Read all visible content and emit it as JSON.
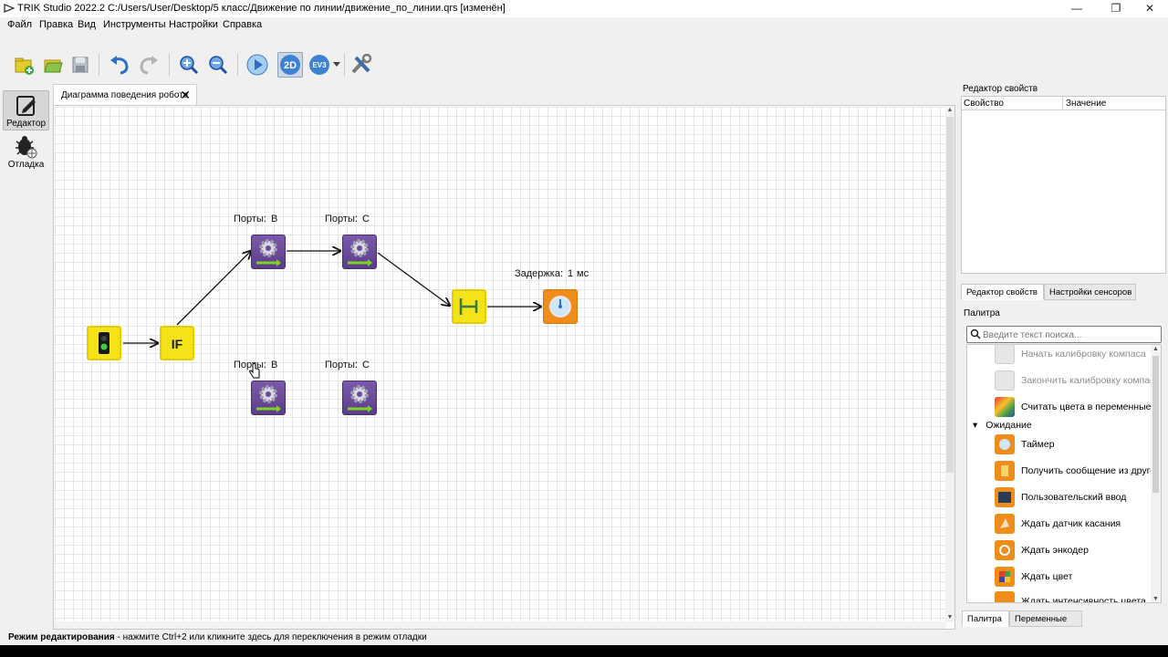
{
  "window": {
    "title": "TRIK Studio 2022.2 C:/Users/User/Desktop/5 класс/Движение по линии/движение_по_линии.qrs [изменён]",
    "minimize": "—",
    "restore": "❐",
    "close": "✕"
  },
  "menu": [
    "Файл",
    "Правка",
    "Вид",
    "Инструменты",
    "Настройки",
    "Справка"
  ],
  "toolbar": {
    "icons": [
      "new-project-icon",
      "open-project-icon",
      "save-icon",
      "undo-icon",
      "redo-icon",
      "zoom-in-icon",
      "zoom-out-icon",
      "run-icon",
      "2d-model-icon",
      "ev3-icon",
      "settings-tools-icon"
    ],
    "twod_label": "2D",
    "ev3_label": "EV3"
  },
  "modes": [
    {
      "label": "Редактор",
      "active": true
    },
    {
      "label": "Отладка",
      "active": false
    }
  ],
  "tab": {
    "label": "Диаграмма поведения робота",
    "close": "✕"
  },
  "diagram": {
    "nodes": [
      {
        "id": "start",
        "kind": "initial"
      },
      {
        "id": "if",
        "kind": "if",
        "label": "IF"
      },
      {
        "id": "motor_b_top",
        "kind": "motors-forward",
        "caption_label": "Порты:",
        "caption_value": "B"
      },
      {
        "id": "motor_c_top",
        "kind": "motors-forward",
        "caption_label": "Порты:",
        "caption_value": "C"
      },
      {
        "id": "fork",
        "kind": "fork"
      },
      {
        "id": "timer",
        "kind": "timer",
        "caption_label": "Задержка:",
        "caption_value": "1",
        "caption_unit": "мс"
      },
      {
        "id": "motor_b_bottom",
        "kind": "motors-forward",
        "caption_label": "Порты:",
        "caption_value": "B"
      },
      {
        "id": "motor_c_bottom",
        "kind": "motors-forward",
        "caption_label": "Порты:",
        "caption_value": "C"
      }
    ]
  },
  "properties": {
    "title": "Редактор свойств",
    "col_property": "Свойство",
    "col_value": "Значение"
  },
  "prop_tabs": [
    "Редактор свойств",
    "Настройки сенсоров"
  ],
  "palette": {
    "title": "Палитра",
    "search_placeholder": "Введите текст поиска...",
    "items_before": [
      {
        "label": "Начать калибровку компаса",
        "disabled": true,
        "icon": "compass-calibrate-start-icon"
      },
      {
        "label": "Закончить калибровку компаса",
        "disabled": true,
        "icon": "compass-calibrate-stop-icon"
      },
      {
        "label": "Считать цвета в переменные",
        "disabled": false,
        "icon": "read-colors-icon"
      }
    ],
    "group": "Ожидание",
    "group_items": [
      {
        "label": "Таймер",
        "icon": "timer-icon"
      },
      {
        "label": "Получить сообщение из другой",
        "icon": "receive-message-icon"
      },
      {
        "label": "Пользовательский ввод",
        "icon": "user-input-icon"
      },
      {
        "label": "Ждать датчик касания",
        "icon": "wait-touch-icon"
      },
      {
        "label": "Ждать энкодер",
        "icon": "wait-encoder-icon"
      },
      {
        "label": "Ждать цвет",
        "icon": "wait-color-icon"
      },
      {
        "label": "Ждать интенсивность цвета",
        "icon": "wait-color-intensity-icon"
      }
    ]
  },
  "bottom_tabs": [
    "Палитра",
    "Переменные"
  ],
  "status": {
    "bold": "Режим редактирования",
    "text": " - нажмите Ctrl+2 или кликните здесь для переключения в режим отладки"
  },
  "colors": {
    "yellow_block": "#f5e31a",
    "purple_block": "#6b4a98",
    "orange_block": "#f08c1a",
    "accent_blue": "#2f7bd6"
  }
}
